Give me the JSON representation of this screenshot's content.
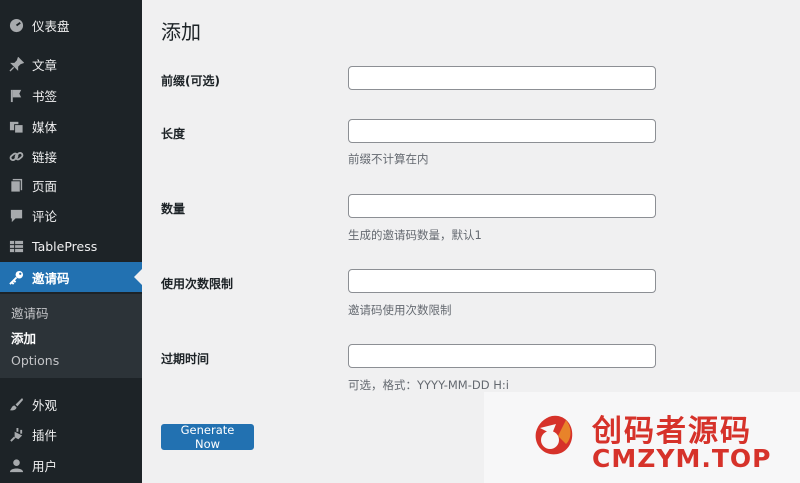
{
  "sidebar": {
    "items": [
      {
        "label": "仪表盘",
        "icon": "dashboard-icon"
      },
      {
        "label": "文章",
        "icon": "pin-icon"
      },
      {
        "label": "书签",
        "icon": "flag-icon"
      },
      {
        "label": "媒体",
        "icon": "media-icon"
      },
      {
        "label": "链接",
        "icon": "link-icon"
      },
      {
        "label": "页面",
        "icon": "page-icon"
      },
      {
        "label": "评论",
        "icon": "comment-icon"
      },
      {
        "label": "TablePress",
        "icon": "table-icon"
      },
      {
        "label": "邀请码",
        "icon": "key-icon",
        "active": true
      },
      {
        "label": "外观",
        "icon": "brush-icon"
      },
      {
        "label": "插件",
        "icon": "plugin-icon"
      },
      {
        "label": "用户",
        "icon": "user-icon"
      }
    ],
    "submenu": [
      {
        "label": "邀请码"
      },
      {
        "label": "添加",
        "current": true
      },
      {
        "label": "Options"
      }
    ]
  },
  "page": {
    "title": "添加",
    "fields": [
      {
        "label": "前缀(可选)",
        "value": "",
        "description": ""
      },
      {
        "label": "长度",
        "value": "",
        "description": "前缀不计算在内"
      },
      {
        "label": "数量",
        "value": "",
        "description": "生成的邀请码数量，默认1"
      },
      {
        "label": "使用次数限制",
        "value": "",
        "description": "邀请码使用次数限制"
      },
      {
        "label": "过期时间",
        "value": "",
        "description": "可选，格式：YYYY-MM-DD H:i"
      }
    ],
    "button_label": "Generate Now"
  },
  "watermark": {
    "cn_text": "创码者源码",
    "en_text": "CMZYM.TOP"
  },
  "colors": {
    "sidebar_bg": "#1d2327",
    "accent": "#2271b1",
    "page_bg": "#f0f0f1",
    "watermark_red": "#d6322a"
  }
}
